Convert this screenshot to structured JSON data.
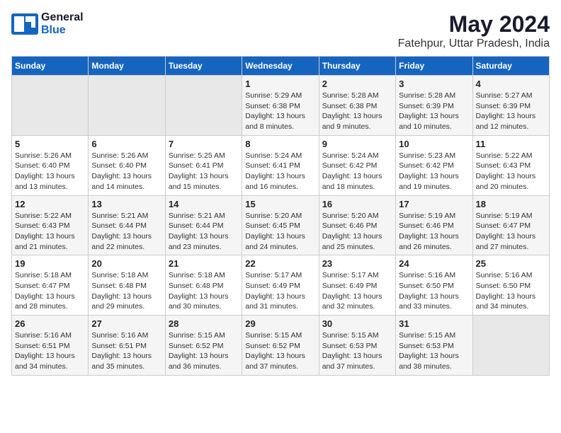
{
  "logo": {
    "general": "General",
    "blue": "Blue"
  },
  "title": {
    "month": "May 2024",
    "location": "Fatehpur, Uttar Pradesh, India"
  },
  "weekdays": [
    "Sunday",
    "Monday",
    "Tuesday",
    "Wednesday",
    "Thursday",
    "Friday",
    "Saturday"
  ],
  "weeks": [
    [
      {
        "day": "",
        "info": ""
      },
      {
        "day": "",
        "info": ""
      },
      {
        "day": "",
        "info": ""
      },
      {
        "day": "1",
        "info": "Sunrise: 5:29 AM\nSunset: 6:38 PM\nDaylight: 13 hours\nand 8 minutes."
      },
      {
        "day": "2",
        "info": "Sunrise: 5:28 AM\nSunset: 6:38 PM\nDaylight: 13 hours\nand 9 minutes."
      },
      {
        "day": "3",
        "info": "Sunrise: 5:28 AM\nSunset: 6:39 PM\nDaylight: 13 hours\nand 10 minutes."
      },
      {
        "day": "4",
        "info": "Sunrise: 5:27 AM\nSunset: 6:39 PM\nDaylight: 13 hours\nand 12 minutes."
      }
    ],
    [
      {
        "day": "5",
        "info": "Sunrise: 5:26 AM\nSunset: 6:40 PM\nDaylight: 13 hours\nand 13 minutes."
      },
      {
        "day": "6",
        "info": "Sunrise: 5:26 AM\nSunset: 6:40 PM\nDaylight: 13 hours\nand 14 minutes."
      },
      {
        "day": "7",
        "info": "Sunrise: 5:25 AM\nSunset: 6:41 PM\nDaylight: 13 hours\nand 15 minutes."
      },
      {
        "day": "8",
        "info": "Sunrise: 5:24 AM\nSunset: 6:41 PM\nDaylight: 13 hours\nand 16 minutes."
      },
      {
        "day": "9",
        "info": "Sunrise: 5:24 AM\nSunset: 6:42 PM\nDaylight: 13 hours\nand 18 minutes."
      },
      {
        "day": "10",
        "info": "Sunrise: 5:23 AM\nSunset: 6:42 PM\nDaylight: 13 hours\nand 19 minutes."
      },
      {
        "day": "11",
        "info": "Sunrise: 5:22 AM\nSunset: 6:43 PM\nDaylight: 13 hours\nand 20 minutes."
      }
    ],
    [
      {
        "day": "12",
        "info": "Sunrise: 5:22 AM\nSunset: 6:43 PM\nDaylight: 13 hours\nand 21 minutes."
      },
      {
        "day": "13",
        "info": "Sunrise: 5:21 AM\nSunset: 6:44 PM\nDaylight: 13 hours\nand 22 minutes."
      },
      {
        "day": "14",
        "info": "Sunrise: 5:21 AM\nSunset: 6:44 PM\nDaylight: 13 hours\nand 23 minutes."
      },
      {
        "day": "15",
        "info": "Sunrise: 5:20 AM\nSunset: 6:45 PM\nDaylight: 13 hours\nand 24 minutes."
      },
      {
        "day": "16",
        "info": "Sunrise: 5:20 AM\nSunset: 6:46 PM\nDaylight: 13 hours\nand 25 minutes."
      },
      {
        "day": "17",
        "info": "Sunrise: 5:19 AM\nSunset: 6:46 PM\nDaylight: 13 hours\nand 26 minutes."
      },
      {
        "day": "18",
        "info": "Sunrise: 5:19 AM\nSunset: 6:47 PM\nDaylight: 13 hours\nand 27 minutes."
      }
    ],
    [
      {
        "day": "19",
        "info": "Sunrise: 5:18 AM\nSunset: 6:47 PM\nDaylight: 13 hours\nand 28 minutes."
      },
      {
        "day": "20",
        "info": "Sunrise: 5:18 AM\nSunset: 6:48 PM\nDaylight: 13 hours\nand 29 minutes."
      },
      {
        "day": "21",
        "info": "Sunrise: 5:18 AM\nSunset: 6:48 PM\nDaylight: 13 hours\nand 30 minutes."
      },
      {
        "day": "22",
        "info": "Sunrise: 5:17 AM\nSunset: 6:49 PM\nDaylight: 13 hours\nand 31 minutes."
      },
      {
        "day": "23",
        "info": "Sunrise: 5:17 AM\nSunset: 6:49 PM\nDaylight: 13 hours\nand 32 minutes."
      },
      {
        "day": "24",
        "info": "Sunrise: 5:16 AM\nSunset: 6:50 PM\nDaylight: 13 hours\nand 33 minutes."
      },
      {
        "day": "25",
        "info": "Sunrise: 5:16 AM\nSunset: 6:50 PM\nDaylight: 13 hours\nand 34 minutes."
      }
    ],
    [
      {
        "day": "26",
        "info": "Sunrise: 5:16 AM\nSunset: 6:51 PM\nDaylight: 13 hours\nand 34 minutes."
      },
      {
        "day": "27",
        "info": "Sunrise: 5:16 AM\nSunset: 6:51 PM\nDaylight: 13 hours\nand 35 minutes."
      },
      {
        "day": "28",
        "info": "Sunrise: 5:15 AM\nSunset: 6:52 PM\nDaylight: 13 hours\nand 36 minutes."
      },
      {
        "day": "29",
        "info": "Sunrise: 5:15 AM\nSunset: 6:52 PM\nDaylight: 13 hours\nand 37 minutes."
      },
      {
        "day": "30",
        "info": "Sunrise: 5:15 AM\nSunset: 6:53 PM\nDaylight: 13 hours\nand 37 minutes."
      },
      {
        "day": "31",
        "info": "Sunrise: 5:15 AM\nSunset: 6:53 PM\nDaylight: 13 hours\nand 38 minutes."
      },
      {
        "day": "",
        "info": ""
      }
    ]
  ]
}
